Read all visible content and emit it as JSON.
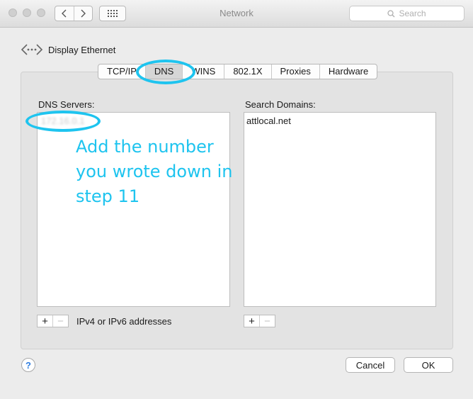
{
  "window": {
    "title": "Network"
  },
  "search": {
    "placeholder": "Search"
  },
  "device": {
    "name": "Display Ethernet"
  },
  "tabs": [
    {
      "label": "TCP/IP"
    },
    {
      "label": "DNS",
      "active": true
    },
    {
      "label": "WINS"
    },
    {
      "label": "802.1X"
    },
    {
      "label": "Proxies"
    },
    {
      "label": "Hardware"
    }
  ],
  "dns": {
    "label": "DNS Servers:",
    "servers": [
      "172.16.0.1"
    ],
    "hint": "IPv4 or IPv6 addresses",
    "add": "+",
    "remove": "−"
  },
  "domains": {
    "label": "Search Domains:",
    "items": [
      "attlocal.net"
    ],
    "add": "+",
    "remove": "−"
  },
  "annotation": {
    "text": "Add the number you wrote down in step 11",
    "color": "#1ec4ef"
  },
  "footer": {
    "help": "?",
    "cancel": "Cancel",
    "ok": "OK"
  }
}
